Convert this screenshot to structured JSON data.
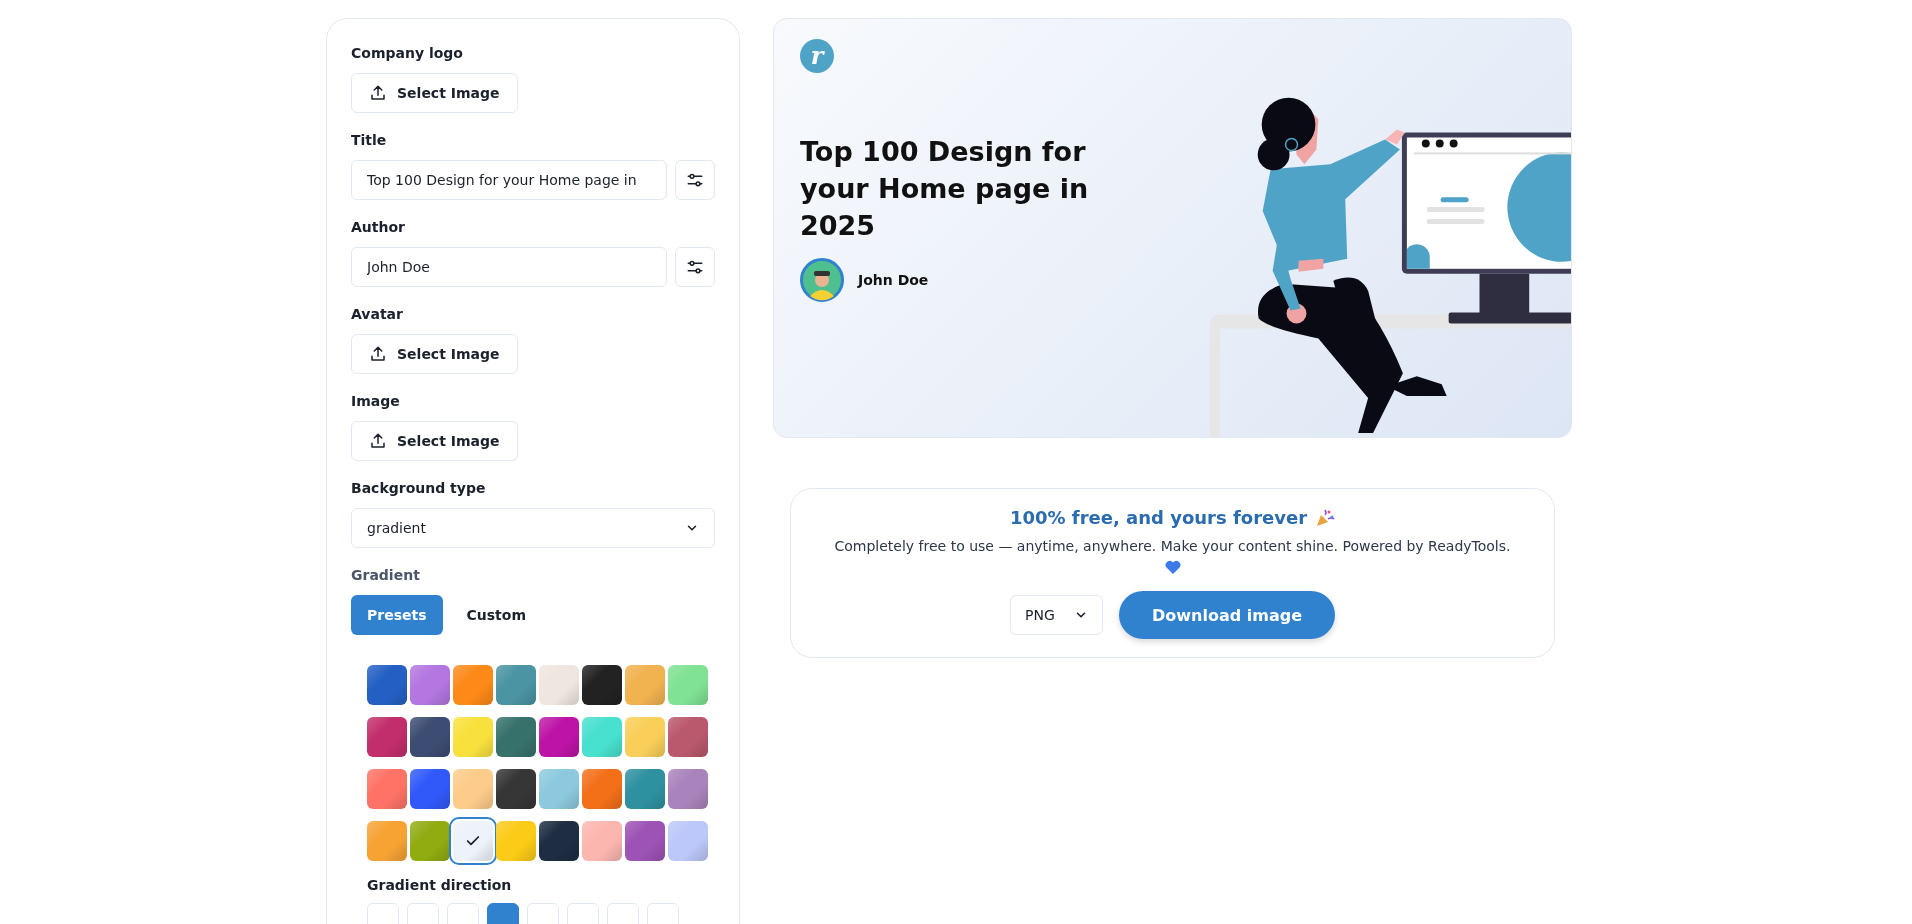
{
  "form": {
    "fields": [
      {
        "kind": "upload",
        "label": "Company logo",
        "button": "Select Image"
      },
      {
        "kind": "text",
        "label": "Title",
        "value": "Top 100 Design for your Home page in"
      },
      {
        "kind": "text",
        "label": "Author",
        "value": "John Doe"
      },
      {
        "kind": "upload",
        "label": "Avatar",
        "button": "Select Image"
      },
      {
        "kind": "upload",
        "label": "Image",
        "button": "Select Image"
      },
      {
        "kind": "select",
        "label": "Background type",
        "value": "gradient"
      }
    ],
    "gradient": {
      "label": "Gradient",
      "tabs": [
        {
          "label": "Presets",
          "selected": true
        },
        {
          "label": "Custom",
          "selected": false
        }
      ],
      "presets": [
        {
          "color": "#2460c4",
          "selected": false
        },
        {
          "color": "#b476e0",
          "selected": false
        },
        {
          "color": "#fd8a18",
          "selected": false
        },
        {
          "color": "#4b94a3",
          "selected": false
        },
        {
          "color": "#efe6df",
          "selected": false
        },
        {
          "color": "#222222",
          "selected": false
        },
        {
          "color": "#f1b250",
          "selected": false
        },
        {
          "color": "#80e293",
          "selected": false
        },
        {
          "color": "#c22e6b",
          "selected": false
        },
        {
          "color": "#3c4c72",
          "selected": false
        },
        {
          "color": "#f9e13d",
          "selected": false
        },
        {
          "color": "#37716b",
          "selected": false
        },
        {
          "color": "#bd13a7",
          "selected": false
        },
        {
          "color": "#48e0ce",
          "selected": false
        },
        {
          "color": "#f9cf5a",
          "selected": false
        },
        {
          "color": "#ba586d",
          "selected": false
        },
        {
          "color": "#ff7366",
          "selected": false
        },
        {
          "color": "#3159fa",
          "selected": false
        },
        {
          "color": "#fdcc8a",
          "selected": false
        },
        {
          "color": "#363636",
          "selected": false
        },
        {
          "color": "#8dc9de",
          "selected": false
        },
        {
          "color": "#f37019",
          "selected": false
        },
        {
          "color": "#2e91a0",
          "selected": false
        },
        {
          "color": "#a984bc",
          "selected": false
        },
        {
          "color": "#f6a334",
          "selected": false
        },
        {
          "color": "#91ac10",
          "selected": false
        },
        {
          "color": "#eef2fa",
          "selected": true
        },
        {
          "color": "#fccb17",
          "selected": false
        },
        {
          "color": "#1e2d43",
          "selected": false
        },
        {
          "color": "#fcb6b0",
          "selected": false
        },
        {
          "color": "#9d52b5",
          "selected": false
        },
        {
          "color": "#bcc8fa",
          "selected": false
        }
      ]
    },
    "gradient_direction": {
      "label": "Gradient direction",
      "options": [
        {
          "selected": false
        },
        {
          "selected": false
        },
        {
          "selected": false
        },
        {
          "selected": true
        },
        {
          "selected": false
        },
        {
          "selected": false
        },
        {
          "selected": false
        },
        {
          "selected": false
        }
      ]
    }
  },
  "preview": {
    "logo": "r",
    "title": "Top 100 Design for your Home page in 2025",
    "author": "John Doe"
  },
  "promo": {
    "heading": "100% free, and yours forever",
    "text": "Completely free to use — anytime, anywhere. Make your content shine. Powered by ReadyTools.",
    "format": "PNG",
    "download": "Download image"
  }
}
